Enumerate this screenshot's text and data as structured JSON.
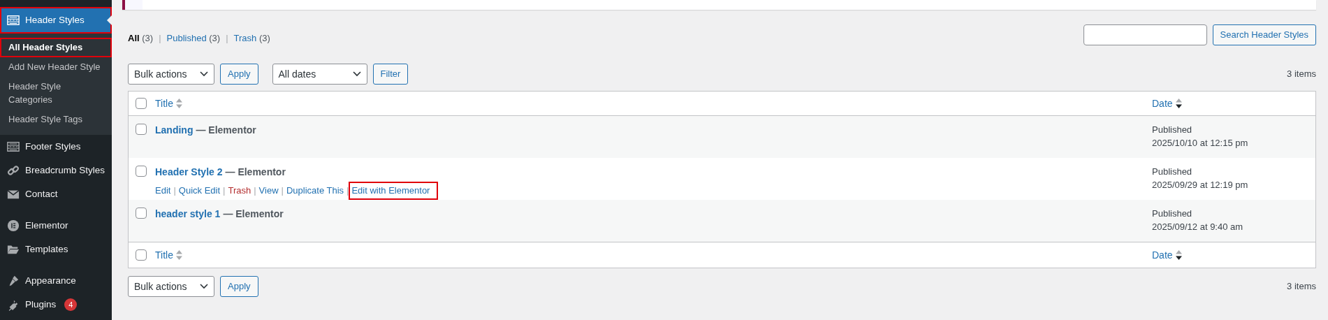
{
  "sidebar": {
    "items": [
      {
        "label": "Header Styles",
        "current": true,
        "highlighted": true,
        "children": [
          {
            "label": "All Header Styles",
            "selected": true,
            "highlighted": true
          },
          {
            "label": "Add New Header Style",
            "selected": false,
            "highlighted": false
          },
          {
            "label": "Header Style Categories",
            "selected": false,
            "highlighted": false
          },
          {
            "label": "Header Style Tags",
            "selected": false,
            "highlighted": false
          }
        ]
      },
      {
        "label": "Footer Styles",
        "current": false,
        "highlighted": false
      },
      {
        "label": "Breadcrumb Styles",
        "current": false,
        "highlighted": false
      },
      {
        "label": "Contact",
        "current": false,
        "highlighted": false
      },
      {
        "label": "Elementor",
        "current": false,
        "highlighted": false
      },
      {
        "label": "Templates",
        "current": false,
        "highlighted": false
      },
      {
        "label": "Appearance",
        "current": false,
        "highlighted": false
      },
      {
        "label": "Plugins",
        "current": false,
        "highlighted": false,
        "badge": "4"
      }
    ]
  },
  "status_filters": [
    {
      "label": "All",
      "count": "(3)",
      "selected": true
    },
    {
      "separator": "|",
      "label": "Published",
      "count": "(3)",
      "selected": false
    },
    {
      "separator": "|",
      "label": "Trash",
      "count": "(3)",
      "selected": false
    }
  ],
  "search": {
    "button": "Search Header Styles"
  },
  "top_actions": {
    "bulk": "Bulk actions",
    "apply": "Apply",
    "dates": "All dates",
    "filter": "Filter",
    "count": "3 items"
  },
  "table": {
    "header": {
      "checked": false,
      "columns": [
        {
          "label": "Title",
          "sorted": false
        },
        {
          "label": "Date",
          "sorted": true
        }
      ]
    },
    "footer": {
      "checked": false,
      "columns": [
        {
          "label": "Title",
          "sorted": false
        },
        {
          "label": "Date",
          "sorted": true
        }
      ]
    },
    "rows": [
      {
        "checked": false,
        "title": "Landing",
        "suffix": "— Elementor",
        "status": "Published",
        "date": "2025/10/10 at 12:15 pm",
        "actions": []
      },
      {
        "checked": false,
        "title": "Header Style 2",
        "suffix": "— Elementor",
        "status": "Published",
        "date": "2025/09/29 at 12:19 pm",
        "actions": [
          {
            "label": "Edit",
            "kind": "link",
            "highlighted": false
          },
          {
            "separator": "|",
            "label": "Quick Edit",
            "kind": "link",
            "highlighted": false
          },
          {
            "separator": "|",
            "label": "Trash",
            "kind": "danger",
            "highlighted": false
          },
          {
            "separator": "|",
            "label": "View",
            "kind": "link",
            "highlighted": false
          },
          {
            "separator": "|",
            "label": "Duplicate This",
            "kind": "link",
            "highlighted": false
          },
          {
            "separator": "|",
            "label": "Edit with Elementor",
            "kind": "link",
            "highlighted": true
          }
        ]
      },
      {
        "checked": false,
        "title": "header style 1",
        "suffix": "— Elementor",
        "status": "Published",
        "date": "2025/09/12 at 9:40 am",
        "actions": []
      }
    ]
  },
  "bottom_actions": {
    "bulk": "Bulk actions",
    "apply": "Apply",
    "count": "3 items"
  }
}
